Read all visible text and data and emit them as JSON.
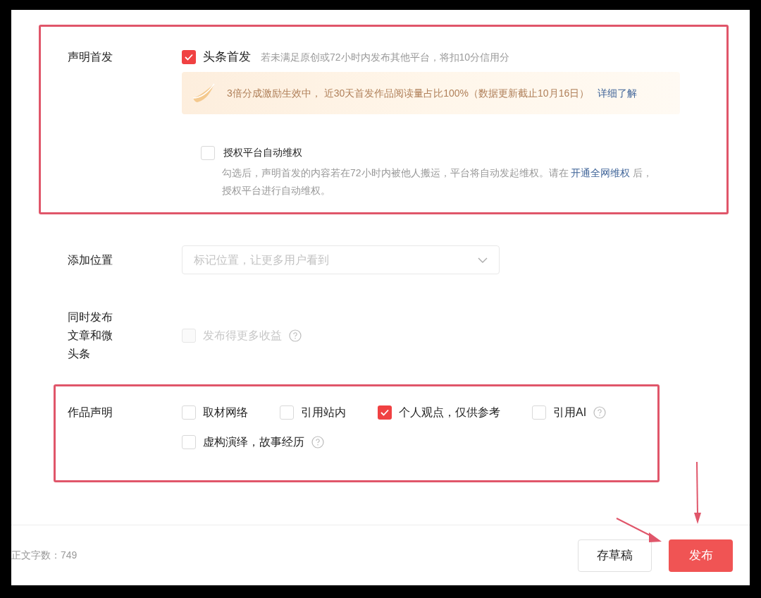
{
  "first_publish": {
    "label": "声明首发",
    "highlighted": true,
    "option": {
      "label": "头条首发",
      "checked": true
    },
    "hint": "若未满足原创或72小时内发布其他平台，将扣10分信用分",
    "banner": {
      "text": "3倍分成激励生效中， 近30天首发作品阅读量占比100%（数据更新截止10月16日）",
      "link": "详细了解"
    },
    "protection": {
      "label": "授权平台自动维权",
      "checked": false,
      "description": "勾选后，声明首发的内容若在72小时内被他人搬运，平台将自动发起维权。请在",
      "link": "开通全网维权",
      "description_after": "后，授权平台进行自动维权。"
    }
  },
  "location": {
    "label": "添加位置",
    "placeholder": "标记位置，让更多用户看到"
  },
  "cross_post": {
    "label": "同时发布文章和微头条",
    "option": {
      "label": "发布得更多收益",
      "checked": false,
      "disabled": true
    }
  },
  "statement": {
    "label": "作品声明",
    "highlighted": true,
    "options": [
      {
        "label": "取材网络",
        "checked": false,
        "help": false
      },
      {
        "label": "引用站内",
        "checked": false,
        "help": false
      },
      {
        "label": "个人观点，仅供参考",
        "checked": true,
        "help": false
      },
      {
        "label": "引用AI",
        "checked": false,
        "help": true
      },
      {
        "label": "虚构演绎，故事经历",
        "checked": false,
        "help": true
      }
    ]
  },
  "footer": {
    "word_count": "正文字数：749",
    "buttons": [
      {
        "label": "存草稿",
        "kind": "secondary"
      },
      {
        "label": "发布",
        "kind": "primary"
      }
    ]
  }
}
